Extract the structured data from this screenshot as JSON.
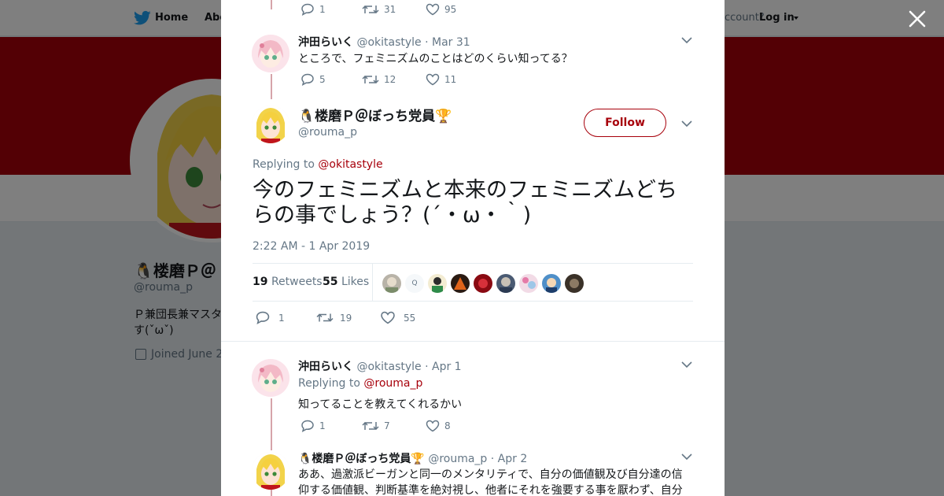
{
  "topnav": {
    "home_label": "Home",
    "about_label": "Abo",
    "account_prompt": "ccount?",
    "login_label": "Log in"
  },
  "background_profile": {
    "name": "🐧楼磨Ｐ＠",
    "handle": "@rouma_p",
    "bio_line1": "Ｐ兼団長兼マスタ",
    "bio_line2": "す(ˇωˇ)",
    "joined": "Joined June 2"
  },
  "thread": {
    "top_actions": {
      "replies": "1",
      "retweets": "31",
      "likes": "95"
    },
    "prev_tweet": {
      "name": "沖田らいく",
      "handle": "@okitastyle",
      "date": "· Mar 31",
      "text": "ところで、フェミニズムのことはどのくらい知ってる？",
      "replies": "5",
      "retweets": "12",
      "likes": "11"
    },
    "main_tweet": {
      "name": "🐧楼磨Ｐ＠ぼっち党員🏆",
      "handle": "@rouma_p",
      "follow_label": "Follow",
      "replying_prefix": "Replying to",
      "replying_to": "@okitastyle",
      "text": "今のフェミニズムと本来のフェミニズムどちらの事でしょう？(´・ω・｀)",
      "timestamp": "2:22 AM - 1 Apr 2019",
      "retweet_count": "19",
      "retweet_label": "Retweets",
      "like_count": "55",
      "like_label": "Likes",
      "liker_initial": "Q",
      "replies": "1",
      "retweets": "19",
      "likes": "55"
    },
    "reply1": {
      "name": "沖田らいく",
      "handle": "@okitastyle",
      "date": "· Apr 1",
      "replying_prefix": "Replying to",
      "replying_to": "@rouma_p",
      "text": "知ってることを教えてくれるかい",
      "replies": "1",
      "retweets": "7",
      "likes": "8"
    },
    "reply2": {
      "name": "🐧楼磨Ｐ＠ぼっち党員🏆",
      "handle": "@rouma_p",
      "date": "· Apr 2",
      "text_line1": "ああ、過激派ビーガンと同一のメンタリティで、自分の価値観及び自分達の信",
      "text_line2": "仰する価値観、判断基準を絶対視し、他者にそれを強要する事を厭わず、自分"
    }
  },
  "colors": {
    "brand": "#a7000b",
    "twitter_blue": "#1da1f2",
    "muted": "#657786",
    "thread_line": "#d6a4aa"
  },
  "icons": {
    "logo": "twitter-bird-icon",
    "reply": "reply-icon",
    "retweet": "retweet-icon",
    "like": "heart-icon",
    "menu": "chevron-down-icon",
    "close": "close-icon",
    "calendar": "calendar-icon"
  }
}
